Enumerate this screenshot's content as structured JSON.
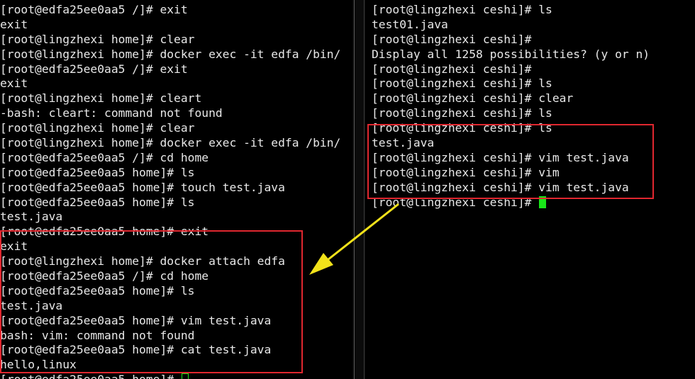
{
  "left_terminal": {
    "lines": [
      {
        "text": "[root@edfa25ee0aa5 /]# exit"
      },
      {
        "text": "exit"
      },
      {
        "text": "[root@lingzhexi home]# clear"
      },
      {
        "text": "[root@lingzhexi home]# docker exec -it edfa /bin/"
      },
      {
        "text": "[root@edfa25ee0aa5 /]# exit"
      },
      {
        "text": "exit"
      },
      {
        "text": "[root@lingzhexi home]# cleart"
      },
      {
        "text": "-bash: cleart: command not found"
      },
      {
        "text": "[root@lingzhexi home]# clear"
      },
      {
        "text": "[root@lingzhexi home]# docker exec -it edfa /bin/"
      },
      {
        "text": "[root@edfa25ee0aa5 /]# cd home"
      },
      {
        "text": "[root@edfa25ee0aa5 home]# ls"
      },
      {
        "text": "[root@edfa25ee0aa5 home]# touch test.java"
      },
      {
        "text": "[root@edfa25ee0aa5 home]# ls"
      },
      {
        "text": "test.java"
      },
      {
        "text": "[root@edfa25ee0aa5 home]# exit"
      },
      {
        "text": "exit"
      },
      {
        "text": "[root@lingzhexi home]# docker attach edfa"
      },
      {
        "text": "[root@edfa25ee0aa5 /]# cd home"
      },
      {
        "text": "[root@edfa25ee0aa5 home]# ls"
      },
      {
        "text": "test.java"
      },
      {
        "text": "[root@edfa25ee0aa5 home]# vim test.java"
      },
      {
        "text": "bash: vim: command not found"
      },
      {
        "text": "[root@edfa25ee0aa5 home]# cat test.java"
      },
      {
        "text": "hello,linux"
      },
      {
        "text": "[root@edfa25ee0aa5 home]# "
      }
    ]
  },
  "right_terminal": {
    "lines": [
      {
        "text": "[root@lingzhexi ceshi]# ls"
      },
      {
        "text": "test01.java"
      },
      {
        "text": "[root@lingzhexi ceshi]#"
      },
      {
        "text": "Display all 1258 possibilities? (y or n)"
      },
      {
        "text": "[root@lingzhexi ceshi]#"
      },
      {
        "text": "[root@lingzhexi ceshi]# ls"
      },
      {
        "text": "[root@lingzhexi ceshi]# clear"
      },
      {
        "text": "[root@lingzhexi ceshi]# ls"
      },
      {
        "text": "[root@lingzhexi ceshi]# ls"
      },
      {
        "text": "test.java"
      },
      {
        "text": "[root@lingzhexi ceshi]# vim test.java"
      },
      {
        "text": "[root@lingzhexi ceshi]# vim"
      },
      {
        "text": "[root@lingzhexi ceshi]# vim test.java"
      },
      {
        "text": "[root@lingzhexi ceshi]# "
      }
    ]
  },
  "colors": {
    "background": "#000000",
    "text": "#e8e8e8",
    "cursor": "#19e619",
    "highlight_box": "#e0272f",
    "arrow": "#f2e21a"
  }
}
